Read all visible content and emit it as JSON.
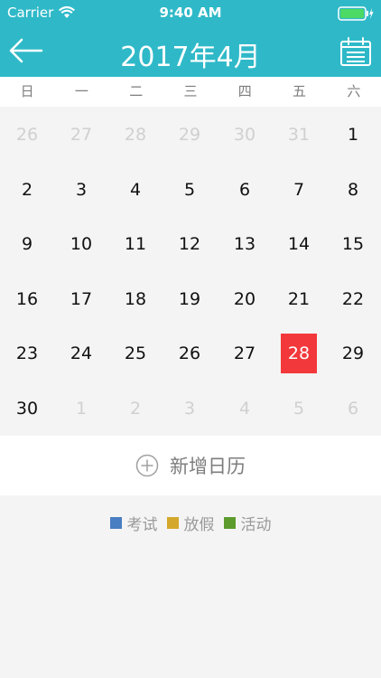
{
  "status_bar": {
    "carrier": "Carrier",
    "time": "9:40 AM"
  },
  "header": {
    "title": "2017年4月",
    "back_icon": "arrow-left-icon",
    "calendar_icon": "calendar-icon"
  },
  "weekdays": [
    "日",
    "一",
    "二",
    "三",
    "四",
    "五",
    "六"
  ],
  "weeks": [
    [
      {
        "day": "26",
        "dim": true
      },
      {
        "day": "27",
        "dim": true
      },
      {
        "day": "28",
        "dim": true
      },
      {
        "day": "29",
        "dim": true
      },
      {
        "day": "30",
        "dim": true
      },
      {
        "day": "31",
        "dim": true
      },
      {
        "day": "1"
      }
    ],
    [
      {
        "day": "2"
      },
      {
        "day": "3"
      },
      {
        "day": "4"
      },
      {
        "day": "5"
      },
      {
        "day": "6"
      },
      {
        "day": "7"
      },
      {
        "day": "8"
      }
    ],
    [
      {
        "day": "9"
      },
      {
        "day": "10"
      },
      {
        "day": "11"
      },
      {
        "day": "12"
      },
      {
        "day": "13"
      },
      {
        "day": "14"
      },
      {
        "day": "15"
      }
    ],
    [
      {
        "day": "16"
      },
      {
        "day": "17"
      },
      {
        "day": "18"
      },
      {
        "day": "19"
      },
      {
        "day": "20"
      },
      {
        "day": "21"
      },
      {
        "day": "22"
      }
    ],
    [
      {
        "day": "23"
      },
      {
        "day": "24"
      },
      {
        "day": "25"
      },
      {
        "day": "26"
      },
      {
        "day": "27"
      },
      {
        "day": "28",
        "selected": true
      },
      {
        "day": "29"
      }
    ],
    [
      {
        "day": "30"
      },
      {
        "day": "1",
        "dim": true
      },
      {
        "day": "2",
        "dim": true
      },
      {
        "day": "3",
        "dim": true
      },
      {
        "day": "4",
        "dim": true
      },
      {
        "day": "5",
        "dim": true
      },
      {
        "day": "6",
        "dim": true
      }
    ]
  ],
  "add_calendar": {
    "label": "新增日历",
    "icon": "plus-circle-icon"
  },
  "legend": [
    {
      "label": "考试",
      "color": "#4a7ec3"
    },
    {
      "label": "放假",
      "color": "#d4a82a"
    },
    {
      "label": "活动",
      "color": "#5d9b2d"
    }
  ],
  "colors": {
    "header": "#2fb9c8",
    "selected_day": "#f2383b"
  }
}
